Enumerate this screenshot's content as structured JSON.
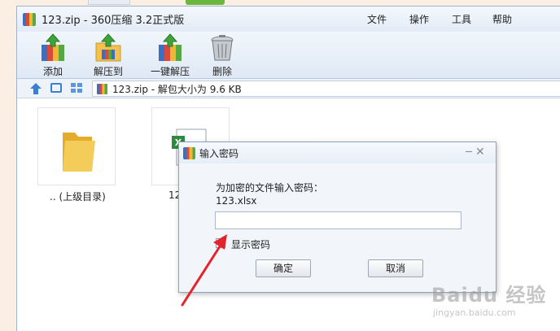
{
  "window": {
    "title": "123.zip - 360压缩 3.2正式版"
  },
  "menu": {
    "file": "文件",
    "operate": "操作",
    "tools": "工具",
    "help": "帮助"
  },
  "toolbar": {
    "add": "添加",
    "extract_to": "解压到",
    "one_click_extract": "一键解压",
    "delete": "删除"
  },
  "path": {
    "text": "123.zip - 解包大小为 9.6 KB"
  },
  "files": {
    "parent": ".. (上级目录)",
    "xlsx_partial": "12"
  },
  "dialog": {
    "title": "输入密码",
    "prompt": "为加密的文件输入密码：",
    "filename": "123.xlsx",
    "password_value": "",
    "show_password": "显示密码",
    "ok": "确定",
    "cancel": "取消",
    "show_password_checked": false
  },
  "watermark": {
    "logo": "Baidu 经验",
    "url": "jingyan.baidu.com"
  },
  "colors": {
    "annotation_arrow": "#e2252b",
    "folder": "#f1c44f",
    "excel_green": "#2f8a3f"
  }
}
